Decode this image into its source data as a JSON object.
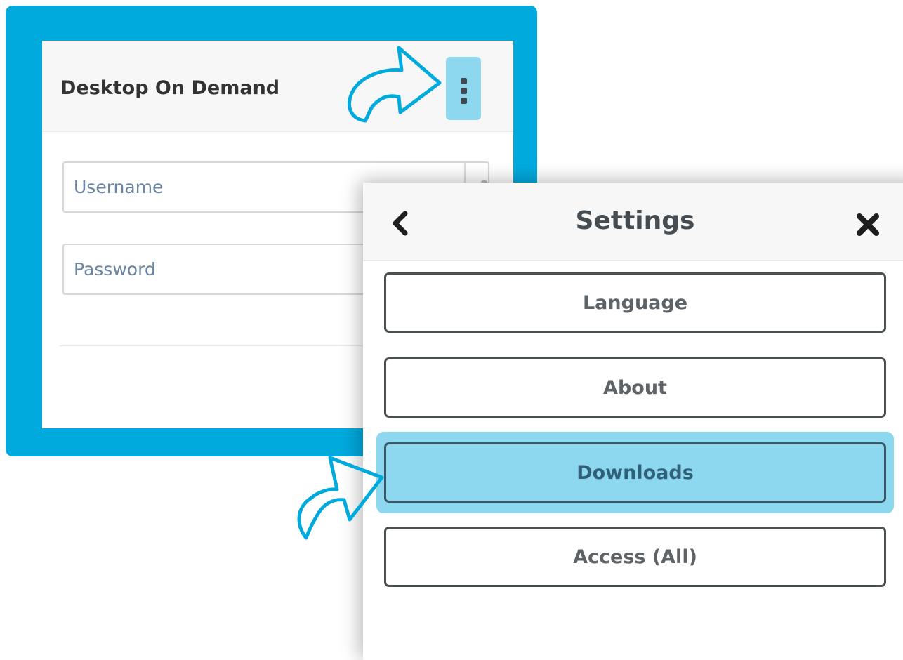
{
  "login_card": {
    "title": "Desktop On Demand",
    "menu_icon": "kebab-menu-icon",
    "username_placeholder": "Username",
    "password_placeholder": "Password"
  },
  "settings": {
    "title": "Settings",
    "back_icon": "chevron-left-icon",
    "close_icon": "close-icon",
    "items": [
      {
        "label": "Language",
        "selected": false
      },
      {
        "label": "About",
        "selected": false
      },
      {
        "label": "Downloads",
        "selected": true
      },
      {
        "label": "Access (All)",
        "selected": false
      }
    ]
  },
  "colors": {
    "frame": "#00aadd",
    "highlight": "#8dd8ef",
    "button_border": "#4a4f52"
  }
}
